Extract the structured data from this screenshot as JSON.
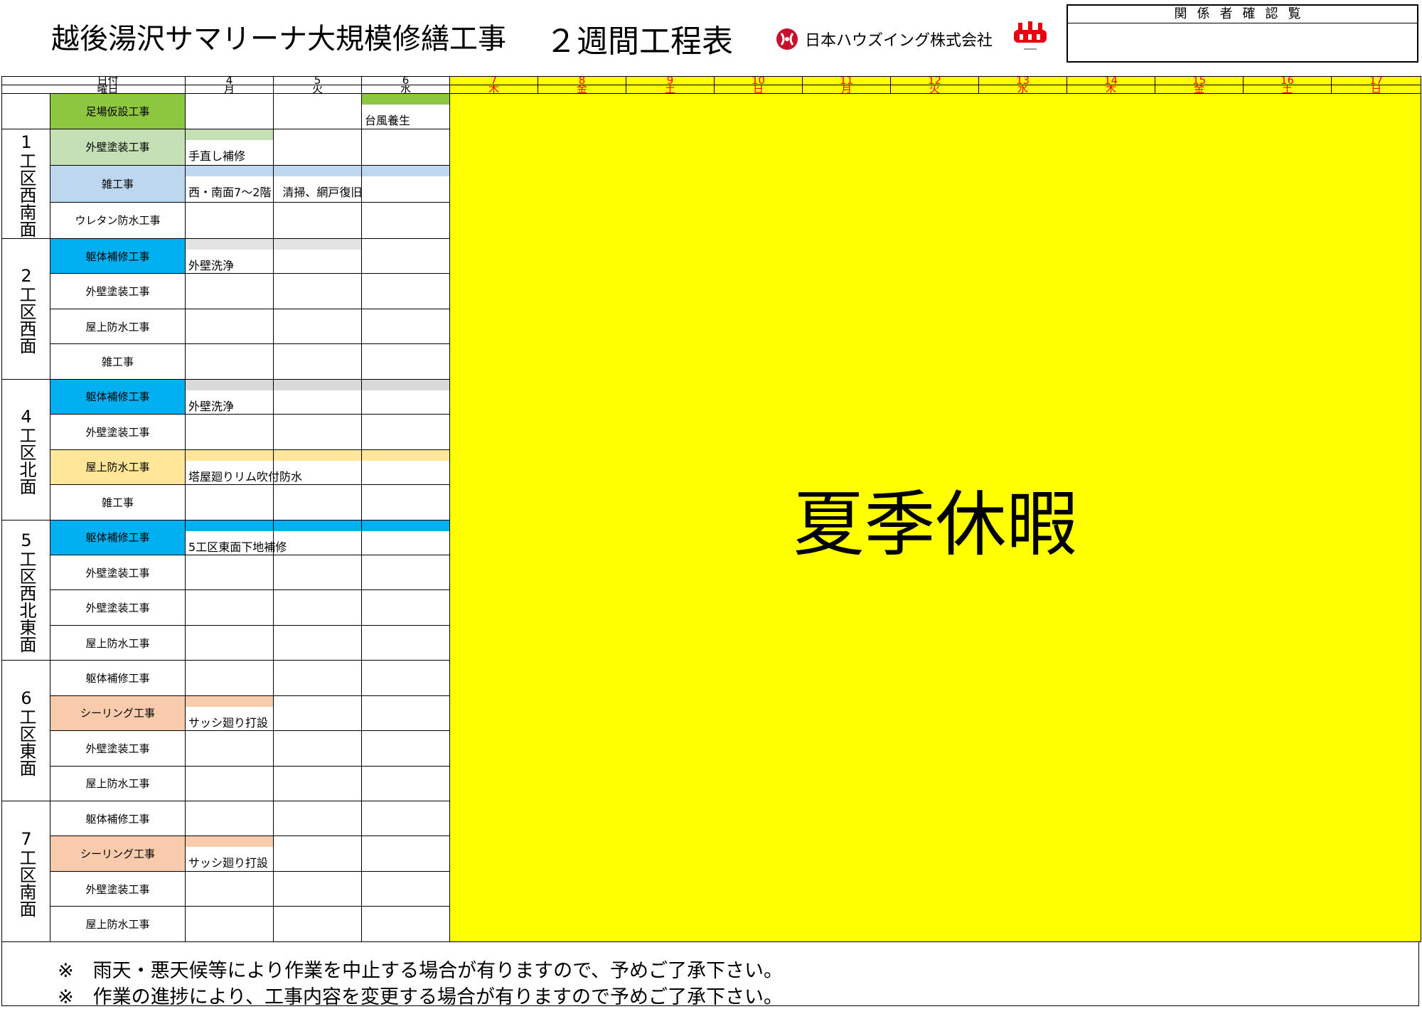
{
  "header": {
    "title": "越後湯沢サマリーナ大規模修繕工事",
    "subtitle": "２週間工程表",
    "company": "日本ハウズイング株式会社",
    "confirm_label": "関係者確認覧"
  },
  "columns": {
    "date_label": "日付",
    "weekday_label": "曜日",
    "days": [
      {
        "d": "4",
        "w": "月"
      },
      {
        "d": "5",
        "w": "火"
      },
      {
        "d": "6",
        "w": "水"
      },
      {
        "d": "7",
        "w": "木"
      },
      {
        "d": "8",
        "w": "金"
      },
      {
        "d": "9",
        "w": "土"
      },
      {
        "d": "10",
        "w": "日"
      },
      {
        "d": "11",
        "w": "月"
      },
      {
        "d": "12",
        "w": "火"
      },
      {
        "d": "13",
        "w": "水"
      },
      {
        "d": "14",
        "w": "木"
      },
      {
        "d": "15",
        "w": "金"
      },
      {
        "d": "16",
        "w": "土"
      },
      {
        "d": "17",
        "w": "日"
      }
    ]
  },
  "holiday_label": "夏季休暇",
  "zones": [
    {
      "name": "",
      "rows": [
        {
          "work": "足場仮設工事",
          "color": "#8dc63f",
          "bars": [
            {
              "start": 2,
              "span": 1,
              "color": "#8dc63f",
              "text": "台風養生"
            }
          ]
        }
      ]
    },
    {
      "name": "1工区西南面",
      "rows": [
        {
          "work": "外壁塗装工事",
          "color": "#c5e0b4",
          "bars": [
            {
              "start": 0,
              "span": 1,
              "color": "#c5e0b4",
              "text": "手直し補修"
            }
          ]
        },
        {
          "work": "雑工事",
          "color": "#bdd7ee",
          "bars": [
            {
              "start": 0,
              "span": 3,
              "color": "#bdd7ee",
              "text": "西・南面7〜2階　清掃、網戸復旧"
            }
          ]
        },
        {
          "work": "ウレタン防水工事",
          "color": "#ffffff",
          "bars": []
        }
      ]
    },
    {
      "name": "2工区西面",
      "rows": [
        {
          "work": "躯体補修工事",
          "color": "#00b0f0",
          "bars": [
            {
              "start": 0,
              "span": 2,
              "color": "#e3e3e3",
              "text": "外壁洗浄"
            }
          ]
        },
        {
          "work": "外壁塗装工事",
          "color": "#ffffff",
          "bars": []
        },
        {
          "work": "屋上防水工事",
          "color": "#ffffff",
          "bars": []
        },
        {
          "work": "雑工事",
          "color": "#ffffff",
          "bars": []
        }
      ]
    },
    {
      "name": "4工区北面",
      "rows": [
        {
          "work": "躯体補修工事",
          "color": "#00b0f0",
          "bars": [
            {
              "start": 0,
              "span": 3,
              "color": "#d9d9d9",
              "text": "外壁洗浄"
            }
          ]
        },
        {
          "work": "外壁塗装工事",
          "color": "#ffffff",
          "bars": []
        },
        {
          "work": "屋上防水工事",
          "color": "#ffe699",
          "bars": [
            {
              "start": 0,
              "span": 3,
              "color": "#ffe699",
              "text": "塔屋廻りリム吹付防水"
            }
          ]
        },
        {
          "work": "雑工事",
          "color": "#ffffff",
          "bars": []
        }
      ]
    },
    {
      "name": "5工区西北東面",
      "rows": [
        {
          "work": "躯体補修工事",
          "color": "#00b0f0",
          "bars": [
            {
              "start": 0,
              "span": 3,
              "color": "#00b0f0",
              "text": "5工区東面下地補修"
            }
          ]
        },
        {
          "work": "外壁塗装工事",
          "color": "#ffffff",
          "bars": []
        },
        {
          "work": "外壁塗装工事",
          "color": "#ffffff",
          "bars": []
        },
        {
          "work": "屋上防水工事",
          "color": "#ffffff",
          "bars": []
        }
      ]
    },
    {
      "name": "6工区東面",
      "rows": [
        {
          "work": "躯体補修工事",
          "color": "#ffffff",
          "bars": []
        },
        {
          "work": "シーリング工事",
          "color": "#f8cbad",
          "bars": [
            {
              "start": 0,
              "span": 1,
              "color": "#f8cbad",
              "text": "サッシ廻り打設"
            }
          ]
        },
        {
          "work": "外壁塗装工事",
          "color": "#ffffff",
          "bars": []
        },
        {
          "work": "屋上防水工事",
          "color": "#ffffff",
          "bars": []
        }
      ]
    },
    {
      "name": "7工区南面",
      "rows": [
        {
          "work": "躯体補修工事",
          "color": "#ffffff",
          "bars": []
        },
        {
          "work": "シーリング工事",
          "color": "#f8cbad",
          "bars": [
            {
              "start": 0,
              "span": 1,
              "color": "#f8cbad",
              "text": "サッシ廻り打設"
            }
          ]
        },
        {
          "work": "外壁塗装工事",
          "color": "#ffffff",
          "bars": []
        },
        {
          "work": "屋上防水工事",
          "color": "#ffffff",
          "bars": []
        }
      ]
    }
  ],
  "notes": [
    "※　雨天・悪天候等により作業を中止する場合が有りますので、予めご了承下さい。",
    "※　作業の進捗により、工事内容を変更する場合が有りますので予めご了承下さい。"
  ]
}
